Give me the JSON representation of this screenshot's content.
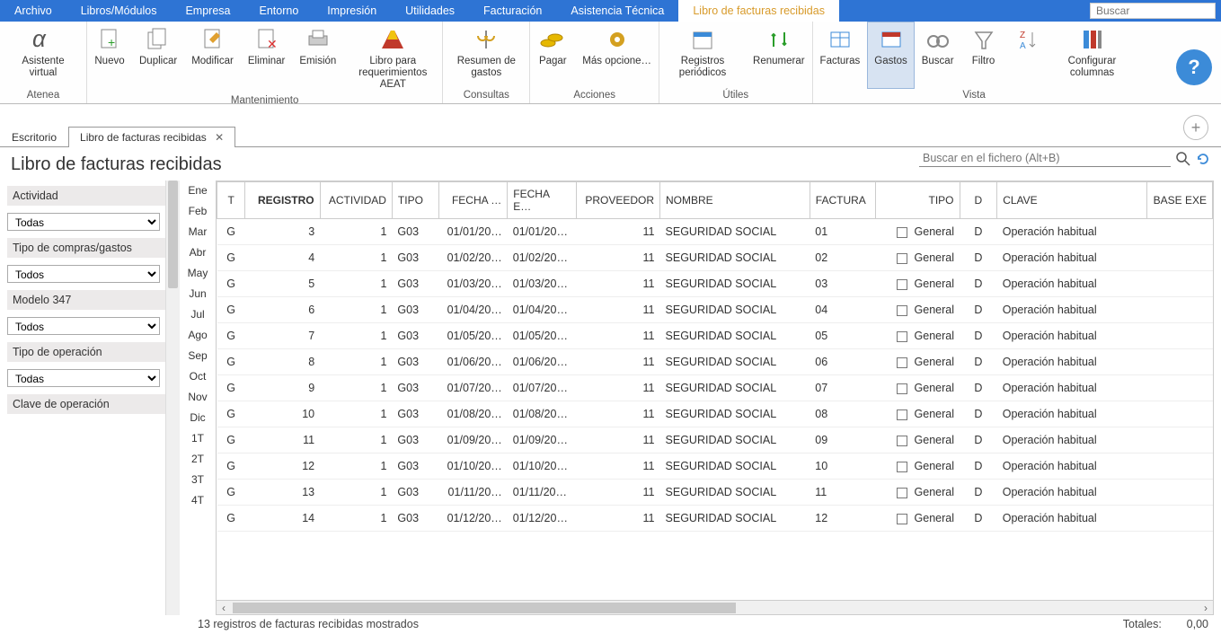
{
  "menu": {
    "items": [
      "Archivo",
      "Libros/Módulos",
      "Empresa",
      "Entorno",
      "Impresión",
      "Utilidades",
      "Facturación",
      "Asistencia Técnica",
      "Libro de facturas recibidas"
    ],
    "active_index": 8,
    "search_placeholder": "Buscar"
  },
  "ribbon": {
    "groups": [
      {
        "label": "Atenea",
        "buttons": [
          {
            "name": "asistente",
            "label": "Asistente virtual"
          }
        ]
      },
      {
        "label": "Mantenimiento",
        "buttons": [
          {
            "name": "nuevo",
            "label": "Nuevo"
          },
          {
            "name": "duplicar",
            "label": "Duplicar"
          },
          {
            "name": "modificar",
            "label": "Modificar"
          },
          {
            "name": "eliminar",
            "label": "Eliminar"
          },
          {
            "name": "emision",
            "label": "Emisión"
          },
          {
            "name": "libro-aeat",
            "label": "Libro para requerimientos AEAT"
          }
        ]
      },
      {
        "label": "Consultas",
        "buttons": [
          {
            "name": "resumen",
            "label": "Resumen de gastos"
          }
        ]
      },
      {
        "label": "Acciones",
        "buttons": [
          {
            "name": "pagar",
            "label": "Pagar"
          },
          {
            "name": "mas-opciones",
            "label": "Más opcione…"
          }
        ]
      },
      {
        "label": "Útiles",
        "buttons": [
          {
            "name": "registros",
            "label": "Registros periódicos"
          },
          {
            "name": "renumerar",
            "label": "Renumerar"
          }
        ]
      },
      {
        "label": "Vista",
        "buttons": [
          {
            "name": "facturas",
            "label": "Facturas"
          },
          {
            "name": "gastos",
            "label": "Gastos",
            "active": true
          },
          {
            "name": "buscar",
            "label": "Buscar"
          },
          {
            "name": "filtro",
            "label": "Filtro"
          },
          {
            "name": "ordenar",
            "label": ""
          },
          {
            "name": "configurar",
            "label": "Configurar columnas"
          }
        ]
      }
    ]
  },
  "tabs": {
    "items": [
      {
        "label": "Escritorio",
        "closable": false
      },
      {
        "label": "Libro de facturas recibidas",
        "closable": true,
        "active": true
      }
    ]
  },
  "page_title": "Libro de facturas recibidas",
  "sidebar": {
    "filters": [
      {
        "label": "Actividad",
        "value": "Todas"
      },
      {
        "label": "Tipo de compras/gastos",
        "value": "Todos"
      },
      {
        "label": "Modelo 347",
        "value": "Todos"
      },
      {
        "label": "Tipo de operación",
        "value": "Todas"
      },
      {
        "label": "Clave de operación",
        "value": ""
      }
    ]
  },
  "months": [
    "Ene",
    "Feb",
    "Mar",
    "Abr",
    "May",
    "Jun",
    "Jul",
    "Ago",
    "Sep",
    "Oct",
    "Nov",
    "Dic",
    "1T",
    "2T",
    "3T",
    "4T"
  ],
  "search_file": {
    "placeholder": "Buscar en el fichero (Alt+B)"
  },
  "grid": {
    "columns": [
      "T",
      "REGISTRO",
      "ACTIVIDAD",
      "TIPO",
      "FECHA …",
      "FECHA E…",
      "PROVEEDOR",
      "NOMBRE",
      "FACTURA",
      "TIPO",
      "D",
      "CLAVE",
      "BASE EXE"
    ],
    "sorted_col": 1,
    "rows": [
      {
        "t": "G",
        "reg": "3",
        "act": "1",
        "tipo": "G03",
        "f1": "01/01/20…",
        "f2": "01/01/20…",
        "prov": "11",
        "nom": "SEGURIDAD SOCIAL",
        "fac": "01",
        "tipo2": "General",
        "d": "D",
        "clave": "Operación habitual"
      },
      {
        "t": "G",
        "reg": "4",
        "act": "1",
        "tipo": "G03",
        "f1": "01/02/20…",
        "f2": "01/02/20…",
        "prov": "11",
        "nom": "SEGURIDAD SOCIAL",
        "fac": "02",
        "tipo2": "General",
        "d": "D",
        "clave": "Operación habitual"
      },
      {
        "t": "G",
        "reg": "5",
        "act": "1",
        "tipo": "G03",
        "f1": "01/03/20…",
        "f2": "01/03/20…",
        "prov": "11",
        "nom": "SEGURIDAD SOCIAL",
        "fac": "03",
        "tipo2": "General",
        "d": "D",
        "clave": "Operación habitual"
      },
      {
        "t": "G",
        "reg": "6",
        "act": "1",
        "tipo": "G03",
        "f1": "01/04/20…",
        "f2": "01/04/20…",
        "prov": "11",
        "nom": "SEGURIDAD SOCIAL",
        "fac": "04",
        "tipo2": "General",
        "d": "D",
        "clave": "Operación habitual"
      },
      {
        "t": "G",
        "reg": "7",
        "act": "1",
        "tipo": "G03",
        "f1": "01/05/20…",
        "f2": "01/05/20…",
        "prov": "11",
        "nom": "SEGURIDAD SOCIAL",
        "fac": "05",
        "tipo2": "General",
        "d": "D",
        "clave": "Operación habitual"
      },
      {
        "t": "G",
        "reg": "8",
        "act": "1",
        "tipo": "G03",
        "f1": "01/06/20…",
        "f2": "01/06/20…",
        "prov": "11",
        "nom": "SEGURIDAD SOCIAL",
        "fac": "06",
        "tipo2": "General",
        "d": "D",
        "clave": "Operación habitual"
      },
      {
        "t": "G",
        "reg": "9",
        "act": "1",
        "tipo": "G03",
        "f1": "01/07/20…",
        "f2": "01/07/20…",
        "prov": "11",
        "nom": "SEGURIDAD SOCIAL",
        "fac": "07",
        "tipo2": "General",
        "d": "D",
        "clave": "Operación habitual"
      },
      {
        "t": "G",
        "reg": "10",
        "act": "1",
        "tipo": "G03",
        "f1": "01/08/20…",
        "f2": "01/08/20…",
        "prov": "11",
        "nom": "SEGURIDAD SOCIAL",
        "fac": "08",
        "tipo2": "General",
        "d": "D",
        "clave": "Operación habitual"
      },
      {
        "t": "G",
        "reg": "11",
        "act": "1",
        "tipo": "G03",
        "f1": "01/09/20…",
        "f2": "01/09/20…",
        "prov": "11",
        "nom": "SEGURIDAD SOCIAL",
        "fac": "09",
        "tipo2": "General",
        "d": "D",
        "clave": "Operación habitual"
      },
      {
        "t": "G",
        "reg": "12",
        "act": "1",
        "tipo": "G03",
        "f1": "01/10/20…",
        "f2": "01/10/20…",
        "prov": "11",
        "nom": "SEGURIDAD SOCIAL",
        "fac": "10",
        "tipo2": "General",
        "d": "D",
        "clave": "Operación habitual"
      },
      {
        "t": "G",
        "reg": "13",
        "act": "1",
        "tipo": "G03",
        "f1": "01/11/20…",
        "f2": "01/11/20…",
        "prov": "11",
        "nom": "SEGURIDAD SOCIAL",
        "fac": "11",
        "tipo2": "General",
        "d": "D",
        "clave": "Operación habitual"
      },
      {
        "t": "G",
        "reg": "14",
        "act": "1",
        "tipo": "G03",
        "f1": "01/12/20…",
        "f2": "01/12/20…",
        "prov": "11",
        "nom": "SEGURIDAD SOCIAL",
        "fac": "12",
        "tipo2": "General",
        "d": "D",
        "clave": "Operación habitual"
      }
    ]
  },
  "status": {
    "count_text": "13 registros de facturas recibidas mostrados",
    "totales_label": "Totales:",
    "totales_value": "0,00"
  }
}
